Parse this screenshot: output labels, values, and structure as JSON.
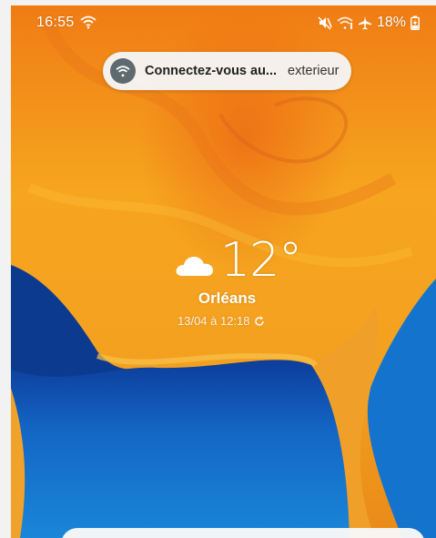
{
  "status_bar": {
    "time": "16:55",
    "battery": "18%",
    "icons": [
      "wifi-icon",
      "mute-icon",
      "wifi-signal-icon",
      "airplane-icon",
      "battery-charging-icon"
    ]
  },
  "notification": {
    "icon": "wifi-icon",
    "title": "Connectez-vous au...",
    "subtitle": "exterieur"
  },
  "weather": {
    "icon": "cloud-icon",
    "temperature": "12°",
    "city": "Orléans",
    "updated": "13/04 à 12:18",
    "refresh_icon": "refresh-icon"
  },
  "colors": {
    "wallpaper_orange": "#f5a11e",
    "wallpaper_blue": "#1564c0",
    "pill_bg": "#f5f5f5"
  }
}
